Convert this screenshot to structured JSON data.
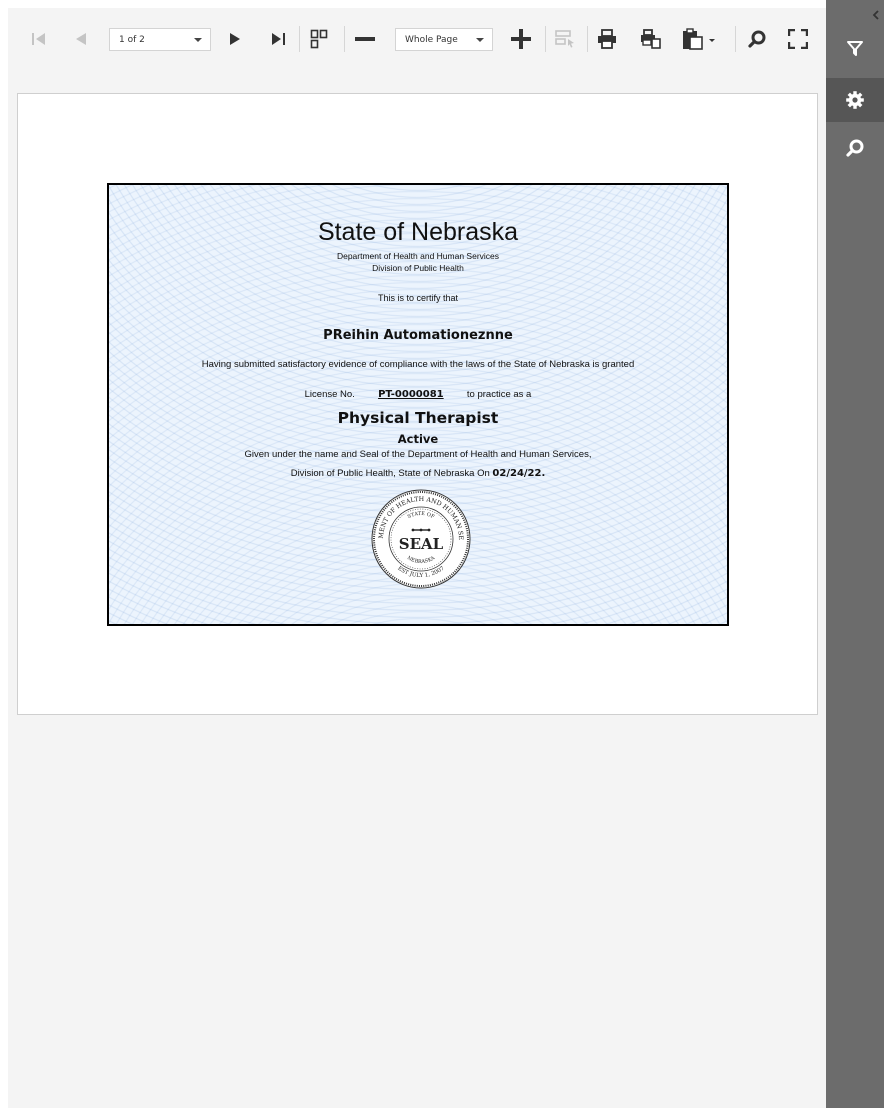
{
  "toolbar": {
    "page_selector": "1 of 2",
    "zoom_selector": "Whole Page",
    "icons": [
      "first-page-icon",
      "previous-page-icon",
      "next-page-icon",
      "last-page-icon",
      "multipage-mode-icon",
      "zoom-out-icon",
      "zoom-in-icon",
      "highlight-editing-fields-icon",
      "print-icon",
      "print-page-icon",
      "export-icon",
      "search-icon",
      "fullscreen-icon"
    ]
  },
  "sidebar": {
    "icons": [
      "collapse-chevron-icon",
      "parameters-filter-icon",
      "settings-gear-icon",
      "search-icon"
    ]
  },
  "certificate": {
    "title": "State of Nebraska",
    "department": "Department of Health and Human Services",
    "division": "Division of Public Health",
    "certify_text": "This is to certify that",
    "holder_name": "PReihin Automationeznne",
    "compliance_text": "Having submitted satisfactory evidence of compliance with the laws of the State of Nebraska is granted",
    "license_label": "License No.",
    "license_number": "PT-0000081",
    "practice_text": "to practice as a",
    "profession": "Physical Therapist",
    "status": "Active",
    "given_line1": "Given under the name and Seal of the Department of Health and Human Services,",
    "given_line2_prefix": "Division of Public Health, State of Nebraska On",
    "issue_date": "02/24/22.",
    "seal": {
      "center_text": "SEAL",
      "top_ring_text": "DEPARTMENT OF HEALTH AND HUMAN SERVICES",
      "inner_top_text": "STATE OF",
      "inner_bottom_text": "NEBRASKA",
      "bottom_ring_text": "EST JULY 1, 2007"
    }
  }
}
